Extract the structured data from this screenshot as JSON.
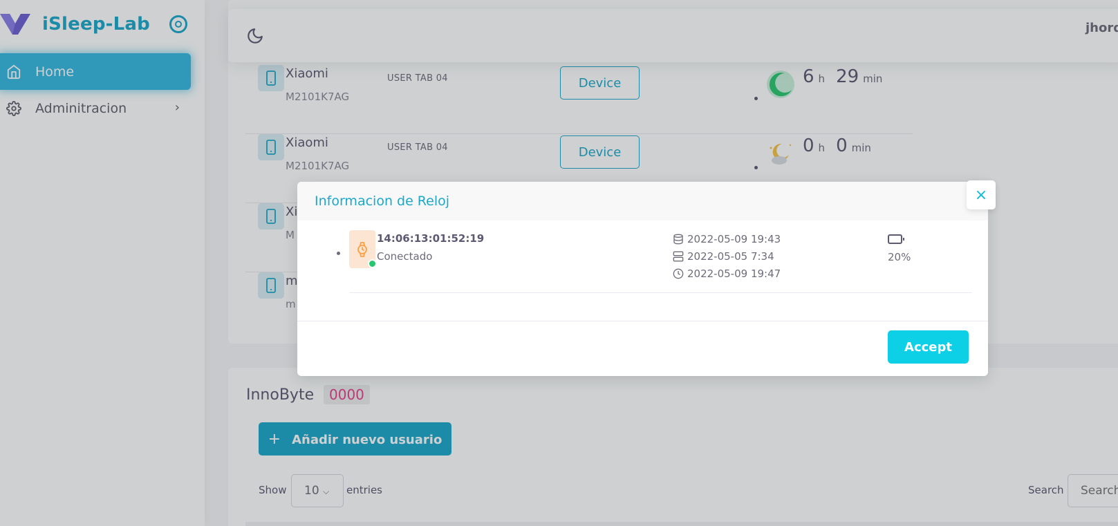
{
  "brand": {
    "name": "iSleep-Lab"
  },
  "sidebar": {
    "items": [
      {
        "label": "Home"
      },
      {
        "label": "Adminitracion"
      }
    ]
  },
  "navbar": {
    "user_name": "jhord"
  },
  "device_rows": [
    {
      "brand": "Xiaomi",
      "model": "M2101K7AG",
      "user": "USER TAB 04",
      "button": "Device",
      "hours": "6",
      "hours_unit": "h",
      "minutes": "29",
      "minutes_unit": "min",
      "sleep_icon": "moon-green-icon"
    },
    {
      "brand": "Xiaomi",
      "model": "M2101K7AG",
      "user": "USER TAB 04",
      "button": "Device",
      "hours": "0",
      "hours_unit": "h",
      "minutes": "0",
      "minutes_unit": "min",
      "sleep_icon": "moon-cloud-icon"
    },
    {
      "brand": "Xi",
      "model": "M"
    },
    {
      "brand": "m",
      "model": "m"
    }
  ],
  "group": {
    "title": "InnoByte",
    "code": "0000",
    "add_button": "Añadir nuevo usuario",
    "show_label": "Show",
    "show_value": "10",
    "entries_label": "entries",
    "search_label": "Search",
    "search_placeholder": "Search"
  },
  "modal": {
    "title": "Informacion de Reloj",
    "close_symbol": "×",
    "watch": {
      "id": "14:06:13:01:52:19",
      "status": "Conectado",
      "data_sync": "2022-05-09 19:43",
      "server_sync": "2022-05-05 7:34",
      "last_time": "2022-05-09 19:47",
      "battery": "20%"
    },
    "accept_button": "Accept"
  },
  "colors": {
    "accent": "#1ca7c9",
    "modal_title": "#1ca7c9",
    "accept": "#0dcfe6",
    "connected": "#28c76f",
    "code": "#e83e8c"
  }
}
